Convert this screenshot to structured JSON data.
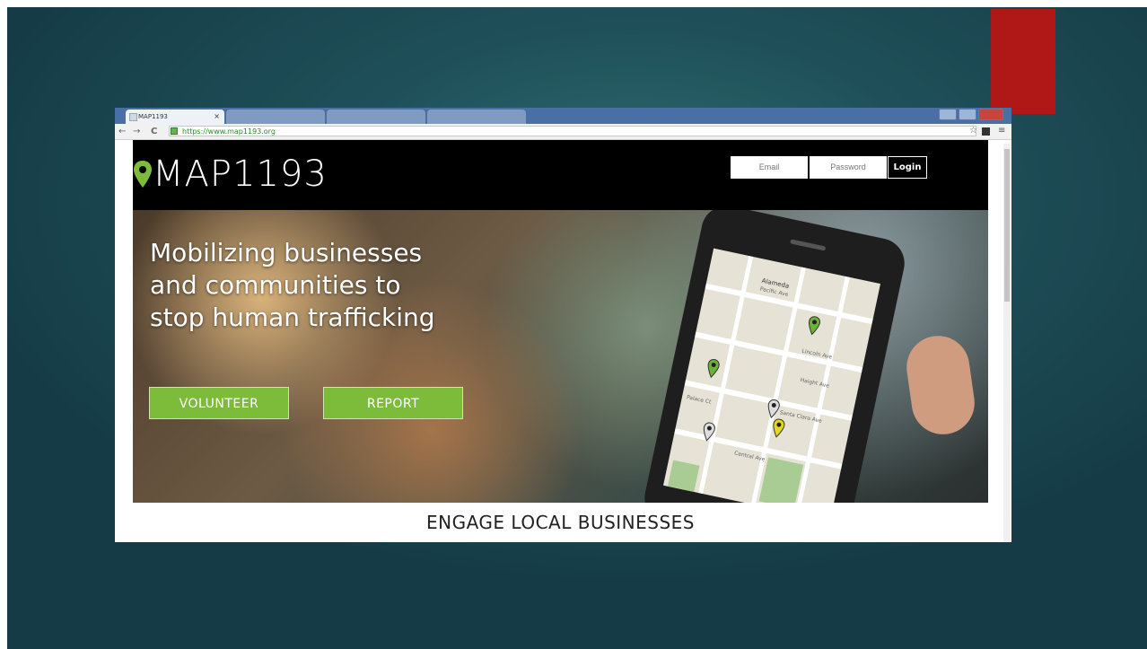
{
  "browser": {
    "active_tab": "MAP1193",
    "url": "https://www.map1193.org",
    "back_glyph": "←",
    "forward_glyph": "→",
    "reload_glyph": "C",
    "star_glyph": "☆",
    "menu_glyph": "≡"
  },
  "site": {
    "logo": "MAP1193",
    "email_placeholder": "Email",
    "password_placeholder": "Password",
    "login_label": "Login",
    "tagline_lines": [
      "Mobilizing businesses",
      "and communities to",
      "stop human trafficking"
    ],
    "volunteer_label": "VOLUNTEER",
    "report_label": "REPORT",
    "section_title": "ENGAGE LOCAL BUSINESSES"
  },
  "map_labels": {
    "alameda": "Alameda",
    "pacific": "Pacific Ave",
    "lincoln": "Lincoln Ave",
    "haight": "Haight Ave",
    "santa_clara": "Santa Clara Ave",
    "central": "Central Ave",
    "palace": "Palace Ct"
  },
  "colors": {
    "accent_red": "#b01818",
    "brand_green": "#7dbb3a",
    "pin_green": "#6bb23a",
    "pin_yellow": "#e8d61f"
  }
}
